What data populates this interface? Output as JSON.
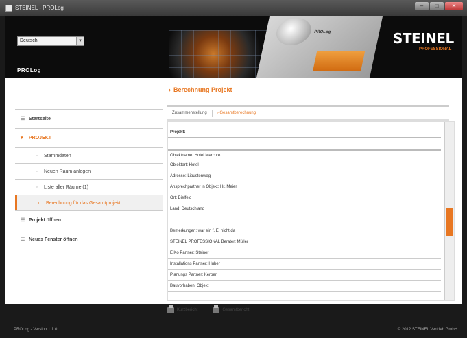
{
  "window": {
    "title": "STEINEL - PROLog"
  },
  "header": {
    "language_select": "Deutsch",
    "app_name": "PROLog",
    "brand": "STEINEL",
    "brand_sub": "PROFESSIONAL",
    "device_label": "PROLog"
  },
  "sidebar": {
    "items": [
      {
        "label": "Startseite"
      },
      {
        "label": "PROJEKT"
      },
      {
        "label": "Stammdaten"
      },
      {
        "label": "Neuen Raum anlegen"
      },
      {
        "label": "Liste aller Räume (1)"
      },
      {
        "label": "Berechnung für das Gesamtprojekt"
      },
      {
        "label": "Projekt öffnen"
      },
      {
        "label": "Neues Fenster öffnen"
      }
    ]
  },
  "main": {
    "title": "Berechnung Projekt",
    "tabs": [
      {
        "label": "Zusammenstellung"
      },
      {
        "label": "Gesamtberechnung"
      }
    ],
    "project_heading": "Projekt:",
    "rows": [
      "Objektname:  Hotel Mercure",
      "Objektart:  Hotel",
      "Adresse:  Lipustenweg",
      "Ansprechpartner in Objekt:  Hr. Meier",
      "Ort:  Bielfeld",
      "Land:  Deutschland",
      "Bemerkungen:  war ein f. E. nicht da",
      "STEINEL PROFESSIONAL Berater:  Müller",
      "ElKo Partner:  Steiner",
      "Installations Partner:  Huber",
      "Planungs Partner:  Kerber",
      "Bauvorhaben:  Objekt"
    ],
    "actions": [
      {
        "label": "Kurzbericht",
        "icon": "printer-icon"
      },
      {
        "label": "Gesamtbericht",
        "icon": "printer-icon"
      }
    ]
  },
  "footer": {
    "version": "PROLog - Version 1.1.0",
    "copyright": "© 2012 STEINEL Vertrieb GmbH"
  },
  "colors": {
    "accent": "#e87722",
    "background": "#1a1a1a",
    "panel": "#ffffff"
  }
}
